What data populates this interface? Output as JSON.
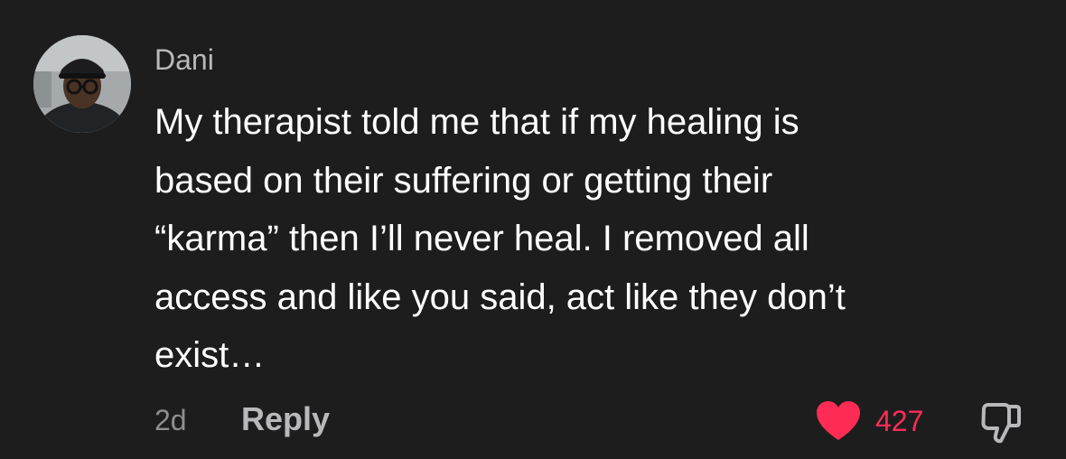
{
  "comment": {
    "author": "Dani",
    "lines": [
      "My therapist told me that if my healing is",
      "based on their suffering or getting their",
      "“karma” then I’ll never heal. I removed all",
      "access and like you said, act like they don’t",
      "exist…"
    ],
    "timestamp": "2d",
    "reply_label": "Reply",
    "like_count": "427"
  },
  "colors": {
    "background": "#1d1d1e",
    "text": "#ffffff",
    "muted": "#b9b9bb",
    "like": "#fe2c55"
  },
  "icons": {
    "avatar": "user-avatar-photo",
    "like": "heart-icon",
    "dislike": "thumbs-down-icon"
  }
}
